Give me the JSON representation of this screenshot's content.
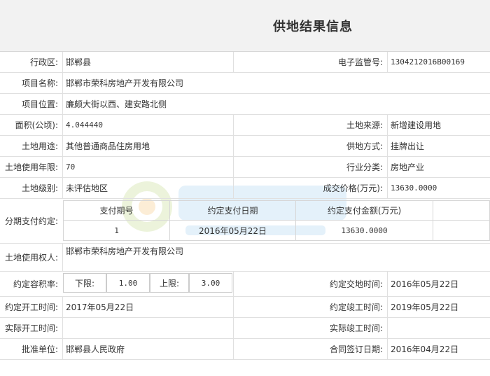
{
  "title": "供地结果信息",
  "rows": {
    "r1": {
      "l1": "行政区:",
      "v1": "邯郸县",
      "l2": "电子监管号:",
      "v2": "1304212016B00169"
    },
    "r2": {
      "l1": "项目名称:",
      "v1": "邯郸市荣科房地产开发有限公司"
    },
    "r3": {
      "l1": "项目位置:",
      "v1": "廉颇大街以西、建安路北侧"
    },
    "r4": {
      "l1": "面积(公顷):",
      "v1": "4.044440",
      "l2": "土地来源:",
      "v2": "新增建设用地"
    },
    "r5": {
      "l1": "土地用途:",
      "v1": "其他普通商品住房用地",
      "l2": "供地方式:",
      "v2": "挂牌出让"
    },
    "r6": {
      "l1": "土地使用年限:",
      "v1": "70",
      "l2": "行业分类:",
      "v2": "房地产业"
    },
    "r7": {
      "l1": "土地级别:",
      "v1": "未评估地区",
      "l2": "成交价格(万元):",
      "v2": "13630.0000"
    },
    "r8": {
      "l1": "分期支付约定:",
      "headers": [
        "支付期号",
        "约定支付日期",
        "约定支付金额(万元)"
      ],
      "cells": [
        "1",
        "2016年05月22日",
        "13630.0000"
      ]
    },
    "r9": {
      "l1": "土地使用权人:",
      "v1": "邯郸市荣科房地产开发有限公司"
    },
    "r10": {
      "l1": "约定容积率:",
      "low_label": "下限:",
      "low": "1.00",
      "high_label": "上限:",
      "high": "3.00",
      "l2": "约定交地时间:",
      "v2": "2016年05月22日"
    },
    "r11": {
      "l1": "约定开工时间:",
      "v1": "2017年05月22日",
      "l2": "约定竣工时间:",
      "v2": "2019年05月22日"
    },
    "r12": {
      "l1": "实际开工时间:",
      "v1": "",
      "l2": "实际竣工时间:",
      "v2": ""
    },
    "r13": {
      "l1": "批准单位:",
      "v1": "邯郸县人民政府",
      "l2": "合同签订日期:",
      "v2": "2016年04月22日"
    }
  }
}
